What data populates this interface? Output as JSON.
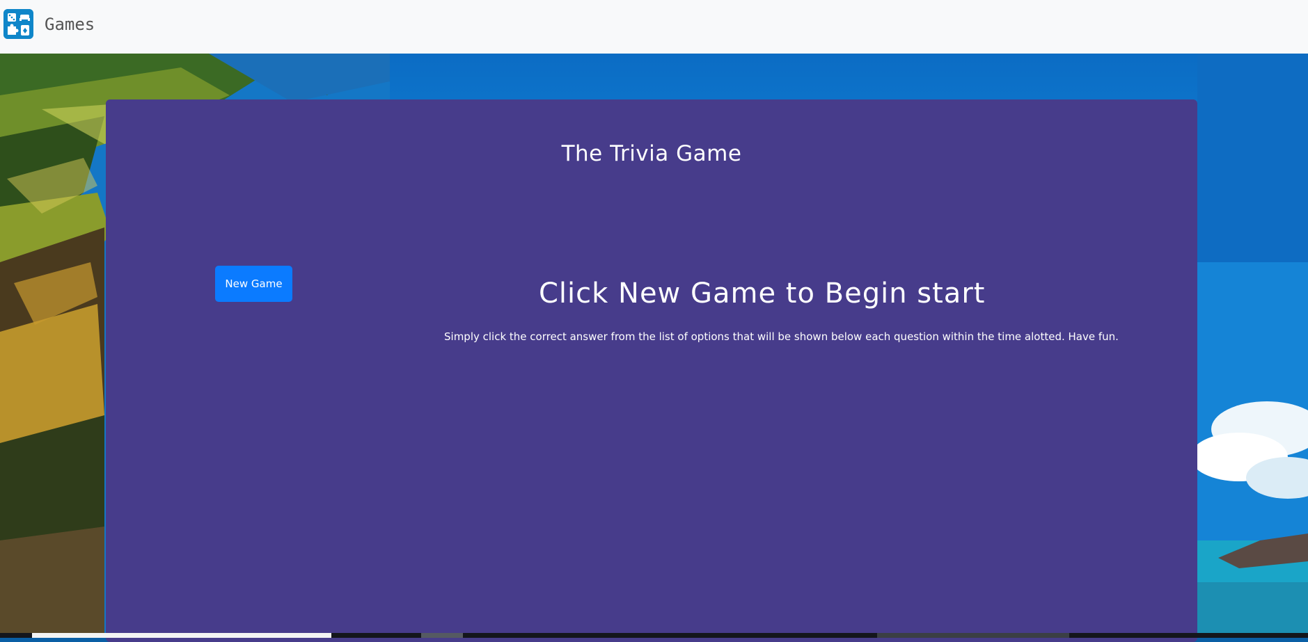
{
  "navbar": {
    "brand_icon": "games-icon",
    "brand_text": "Games"
  },
  "card": {
    "title": "The Trivia Game",
    "new_game_label": "New Game",
    "headline": "Click New Game to Begin start",
    "instructions": "Simply click the correct answer from the list of options that will be shown below each question within the time alotted. Have fun."
  },
  "colors": {
    "navbar_bg": "#f8f9fa",
    "card_bg": "#473c8b",
    "button_bg": "#0b7bff",
    "text": "#ffffff"
  }
}
